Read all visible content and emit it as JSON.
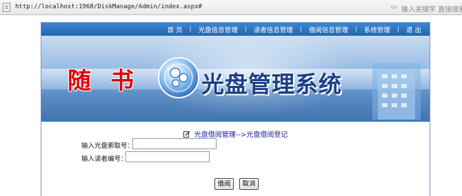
{
  "browser": {
    "url": "http://localhost:1968/DiskManage/Admin/index.aspx#",
    "search_hint": "输入关键字 直接搜索"
  },
  "nav": {
    "items": [
      "首 页",
      "光盘信息管理",
      "读者信息管理",
      "借阅信息管理",
      "系统管理",
      "退 出"
    ],
    "separator": "|"
  },
  "banner": {
    "left_text": "随书",
    "title": "光盘管理系统"
  },
  "form": {
    "breadcrumb": "光盘借阅管理-->光盘借阅登记",
    "disc_id_label": "输入光盘索取号：",
    "disc_id_value": "",
    "reader_id_label": "输入读者编号：",
    "reader_id_value": "",
    "borrow_button": "借阅",
    "cancel_button": "取消"
  },
  "colors": {
    "nav_bg": "#2a70b8",
    "banner_red": "#e00000",
    "title_blue": "#1b3f86",
    "breadcrumb_blue": "#1a1aa0"
  }
}
